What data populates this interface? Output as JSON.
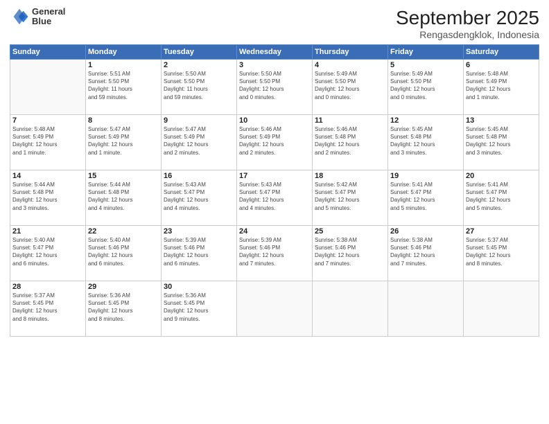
{
  "header": {
    "logo_text_top": "General",
    "logo_text_bottom": "Blue",
    "month": "September 2025",
    "location": "Rengasdengklok, Indonesia"
  },
  "days_of_week": [
    "Sunday",
    "Monday",
    "Tuesday",
    "Wednesday",
    "Thursday",
    "Friday",
    "Saturday"
  ],
  "weeks": [
    [
      {
        "day": "",
        "info": ""
      },
      {
        "day": "1",
        "info": "Sunrise: 5:51 AM\nSunset: 5:50 PM\nDaylight: 11 hours\nand 59 minutes."
      },
      {
        "day": "2",
        "info": "Sunrise: 5:50 AM\nSunset: 5:50 PM\nDaylight: 11 hours\nand 59 minutes."
      },
      {
        "day": "3",
        "info": "Sunrise: 5:50 AM\nSunset: 5:50 PM\nDaylight: 12 hours\nand 0 minutes."
      },
      {
        "day": "4",
        "info": "Sunrise: 5:49 AM\nSunset: 5:50 PM\nDaylight: 12 hours\nand 0 minutes."
      },
      {
        "day": "5",
        "info": "Sunrise: 5:49 AM\nSunset: 5:50 PM\nDaylight: 12 hours\nand 0 minutes."
      },
      {
        "day": "6",
        "info": "Sunrise: 5:48 AM\nSunset: 5:49 PM\nDaylight: 12 hours\nand 1 minute."
      }
    ],
    [
      {
        "day": "7",
        "info": "Sunrise: 5:48 AM\nSunset: 5:49 PM\nDaylight: 12 hours\nand 1 minute."
      },
      {
        "day": "8",
        "info": "Sunrise: 5:47 AM\nSunset: 5:49 PM\nDaylight: 12 hours\nand 1 minute."
      },
      {
        "day": "9",
        "info": "Sunrise: 5:47 AM\nSunset: 5:49 PM\nDaylight: 12 hours\nand 2 minutes."
      },
      {
        "day": "10",
        "info": "Sunrise: 5:46 AM\nSunset: 5:49 PM\nDaylight: 12 hours\nand 2 minutes."
      },
      {
        "day": "11",
        "info": "Sunrise: 5:46 AM\nSunset: 5:48 PM\nDaylight: 12 hours\nand 2 minutes."
      },
      {
        "day": "12",
        "info": "Sunrise: 5:45 AM\nSunset: 5:48 PM\nDaylight: 12 hours\nand 3 minutes."
      },
      {
        "day": "13",
        "info": "Sunrise: 5:45 AM\nSunset: 5:48 PM\nDaylight: 12 hours\nand 3 minutes."
      }
    ],
    [
      {
        "day": "14",
        "info": "Sunrise: 5:44 AM\nSunset: 5:48 PM\nDaylight: 12 hours\nand 3 minutes."
      },
      {
        "day": "15",
        "info": "Sunrise: 5:44 AM\nSunset: 5:48 PM\nDaylight: 12 hours\nand 4 minutes."
      },
      {
        "day": "16",
        "info": "Sunrise: 5:43 AM\nSunset: 5:47 PM\nDaylight: 12 hours\nand 4 minutes."
      },
      {
        "day": "17",
        "info": "Sunrise: 5:43 AM\nSunset: 5:47 PM\nDaylight: 12 hours\nand 4 minutes."
      },
      {
        "day": "18",
        "info": "Sunrise: 5:42 AM\nSunset: 5:47 PM\nDaylight: 12 hours\nand 5 minutes."
      },
      {
        "day": "19",
        "info": "Sunrise: 5:41 AM\nSunset: 5:47 PM\nDaylight: 12 hours\nand 5 minutes."
      },
      {
        "day": "20",
        "info": "Sunrise: 5:41 AM\nSunset: 5:47 PM\nDaylight: 12 hours\nand 5 minutes."
      }
    ],
    [
      {
        "day": "21",
        "info": "Sunrise: 5:40 AM\nSunset: 5:47 PM\nDaylight: 12 hours\nand 6 minutes."
      },
      {
        "day": "22",
        "info": "Sunrise: 5:40 AM\nSunset: 5:46 PM\nDaylight: 12 hours\nand 6 minutes."
      },
      {
        "day": "23",
        "info": "Sunrise: 5:39 AM\nSunset: 5:46 PM\nDaylight: 12 hours\nand 6 minutes."
      },
      {
        "day": "24",
        "info": "Sunrise: 5:39 AM\nSunset: 5:46 PM\nDaylight: 12 hours\nand 7 minutes."
      },
      {
        "day": "25",
        "info": "Sunrise: 5:38 AM\nSunset: 5:46 PM\nDaylight: 12 hours\nand 7 minutes."
      },
      {
        "day": "26",
        "info": "Sunrise: 5:38 AM\nSunset: 5:46 PM\nDaylight: 12 hours\nand 7 minutes."
      },
      {
        "day": "27",
        "info": "Sunrise: 5:37 AM\nSunset: 5:45 PM\nDaylight: 12 hours\nand 8 minutes."
      }
    ],
    [
      {
        "day": "28",
        "info": "Sunrise: 5:37 AM\nSunset: 5:45 PM\nDaylight: 12 hours\nand 8 minutes."
      },
      {
        "day": "29",
        "info": "Sunrise: 5:36 AM\nSunset: 5:45 PM\nDaylight: 12 hours\nand 8 minutes."
      },
      {
        "day": "30",
        "info": "Sunrise: 5:36 AM\nSunset: 5:45 PM\nDaylight: 12 hours\nand 9 minutes."
      },
      {
        "day": "",
        "info": ""
      },
      {
        "day": "",
        "info": ""
      },
      {
        "day": "",
        "info": ""
      },
      {
        "day": "",
        "info": ""
      }
    ]
  ]
}
